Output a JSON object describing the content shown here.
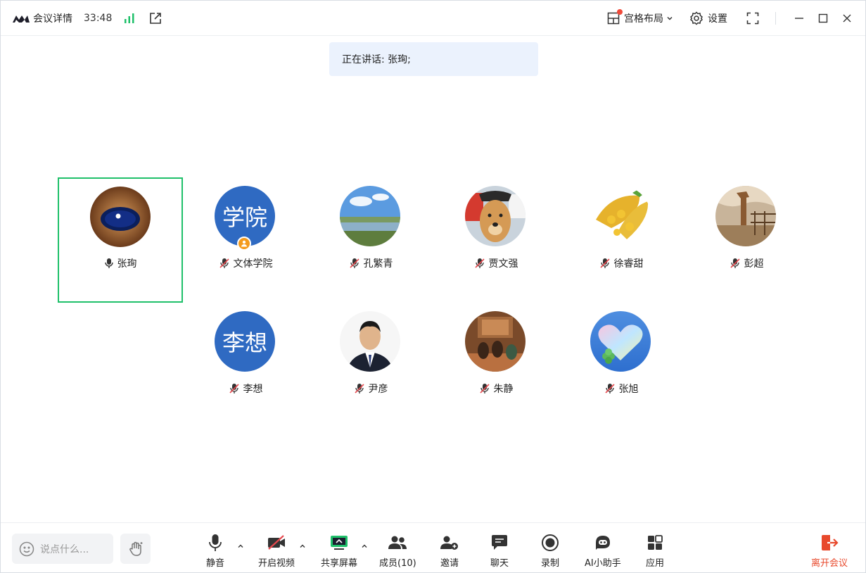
{
  "titlebar": {
    "meeting_details": "会议详情",
    "duration": "33:48",
    "layout_label": "宫格布局",
    "settings_label": "设置"
  },
  "banner": {
    "speaking_text": "正在讲话: 张珣;"
  },
  "participants": [
    {
      "name": "张珣",
      "mic": "on"
    },
    {
      "name": "文体学院",
      "avatar_text": "学院",
      "mic": "muted"
    },
    {
      "name": "孔繁青",
      "mic": "muted"
    },
    {
      "name": "贾文强",
      "mic": "muted"
    },
    {
      "name": "徐睿甜",
      "mic": "muted"
    },
    {
      "name": "彭超",
      "mic": "muted"
    },
    {
      "name": "李想",
      "avatar_text": "李想",
      "mic": "muted"
    },
    {
      "name": "尹彦",
      "mic": "muted"
    },
    {
      "name": "朱静",
      "mic": "muted"
    },
    {
      "name": "张旭",
      "mic": "muted"
    }
  ],
  "toolbar": {
    "chat_placeholder": "说点什么...",
    "mute": "静音",
    "video": "开启视频",
    "share": "共享屏幕",
    "members": "成员(10)",
    "invite": "邀请",
    "chat": "聊天",
    "record": "录制",
    "ai": "AI小助手",
    "apps": "应用",
    "leave": "离开会议"
  },
  "colors": {
    "active_border": "#1fc06a",
    "avatar_text_bg": "#2f6ac2",
    "banner_bg": "#ebf2fd",
    "leave_red": "#e8492c",
    "muted_red": "#e5484d",
    "share_green": "#1fc06a"
  }
}
